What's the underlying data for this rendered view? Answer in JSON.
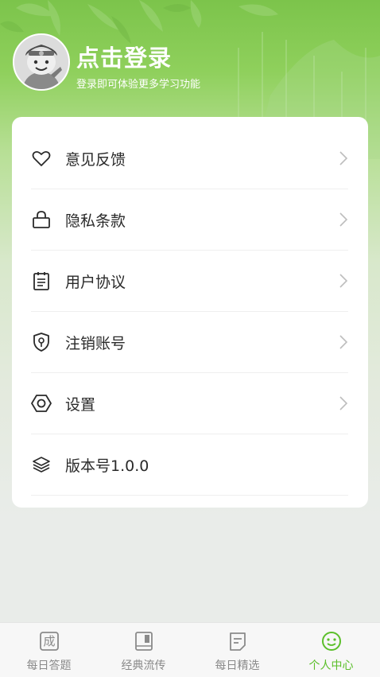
{
  "header": {
    "login_title": "点击登录",
    "login_subtitle": "登录即可体验更多学习功能"
  },
  "menu": {
    "items": [
      {
        "label": "意见反馈",
        "icon": "heart-icon",
        "has_arrow": true
      },
      {
        "label": "隐私条款",
        "icon": "lock-icon",
        "has_arrow": true
      },
      {
        "label": "用户协议",
        "icon": "notepad-icon",
        "has_arrow": true
      },
      {
        "label": "注销账号",
        "icon": "shield-key-icon",
        "has_arrow": true
      },
      {
        "label": "设置",
        "icon": "gear-icon",
        "has_arrow": true
      },
      {
        "label": "版本号1.0.0",
        "icon": "layers-icon",
        "has_arrow": false
      }
    ]
  },
  "tabbar": {
    "tabs": [
      {
        "label": "每日答题",
        "icon": "idiom-character-icon",
        "active": false,
        "glyph": "成"
      },
      {
        "label": "经典流传",
        "icon": "book-icon",
        "active": false
      },
      {
        "label": "每日精选",
        "icon": "document-icon",
        "active": false
      },
      {
        "label": "个人中心",
        "icon": "smiley-icon",
        "active": true
      }
    ]
  },
  "colors": {
    "accent": "#5bbf2a",
    "header_green": "#7cc44b",
    "text_dark": "#2a2a2a",
    "tab_inactive": "#8a8a8a"
  }
}
